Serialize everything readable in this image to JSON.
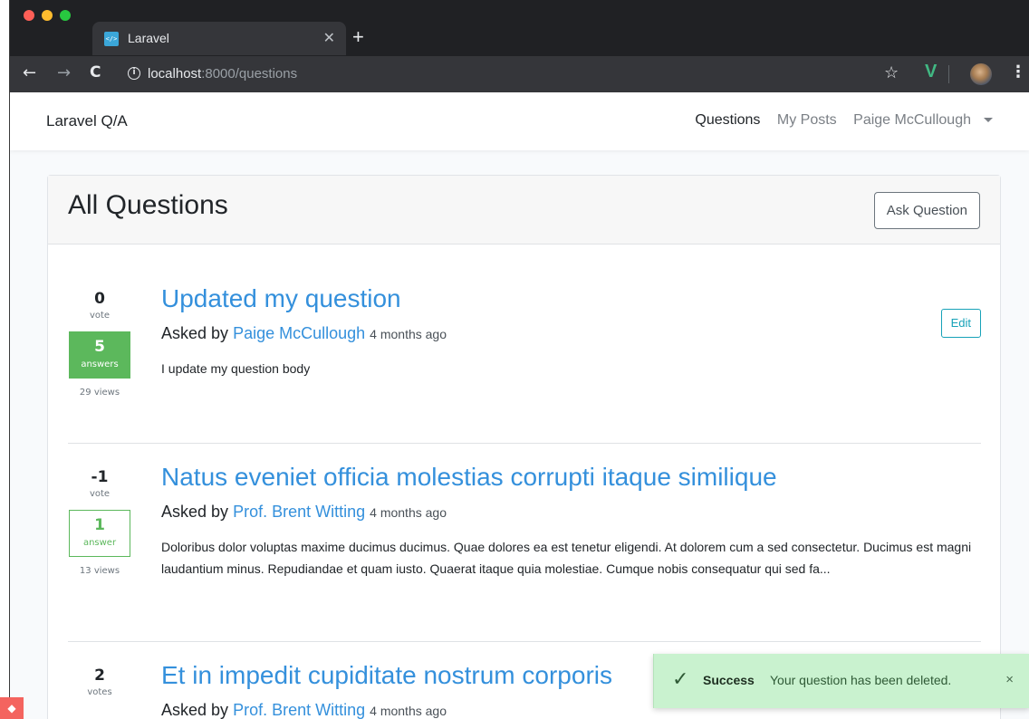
{
  "browser": {
    "tab_title": "Laravel",
    "tab_favicon": "</>",
    "url_host": "localhost",
    "url_rest": ":8000/questions"
  },
  "navbar": {
    "brand": "Laravel Q/A",
    "links": [
      "Questions",
      "My Posts",
      "Paige McCullough"
    ]
  },
  "card": {
    "title": "All Questions",
    "ask_button": "Ask Question"
  },
  "questions": [
    {
      "votes": "0",
      "votes_label": "vote",
      "answers": "5",
      "answers_label": "answers",
      "views": "29 views",
      "title": "Updated my question",
      "asked_by": "Asked by",
      "author": "Paige McCullough",
      "ago": "4 months ago",
      "body": "I update my question body",
      "edit": "Edit"
    },
    {
      "votes": "-1",
      "votes_label": "vote",
      "answers": "1",
      "answers_label": "answer",
      "views": "13 views",
      "title": "Natus eveniet officia molestias corrupti itaque similique",
      "asked_by": "Asked by",
      "author": "Prof. Brent Witting",
      "ago": "4 months ago",
      "body": "Doloribus dolor voluptas maxime ducimus ducimus. Quae dolores ea est tenetur eligendi. At dolorem cum a sed consectetur. Ducimus est magni laudantium minus. Repudiandae et quam iusto. Quaerat itaque quia molestiae. Cumque nobis consequatur qui sed fa..."
    },
    {
      "votes": "2",
      "votes_label": "votes",
      "title": "Et in impedit cupiditate nostrum corporis",
      "asked_by": "Asked by",
      "author": "Prof. Brent Witting",
      "ago": "4 months ago"
    }
  ],
  "toast": {
    "title": "Success",
    "message": "Your question has been deleted.",
    "close": "×"
  },
  "colors": {
    "link": "#3490dc",
    "accepted_green": "#5cb85c",
    "toast_bg": "#c9f2cf",
    "edit_teal": "#17a2b8"
  }
}
